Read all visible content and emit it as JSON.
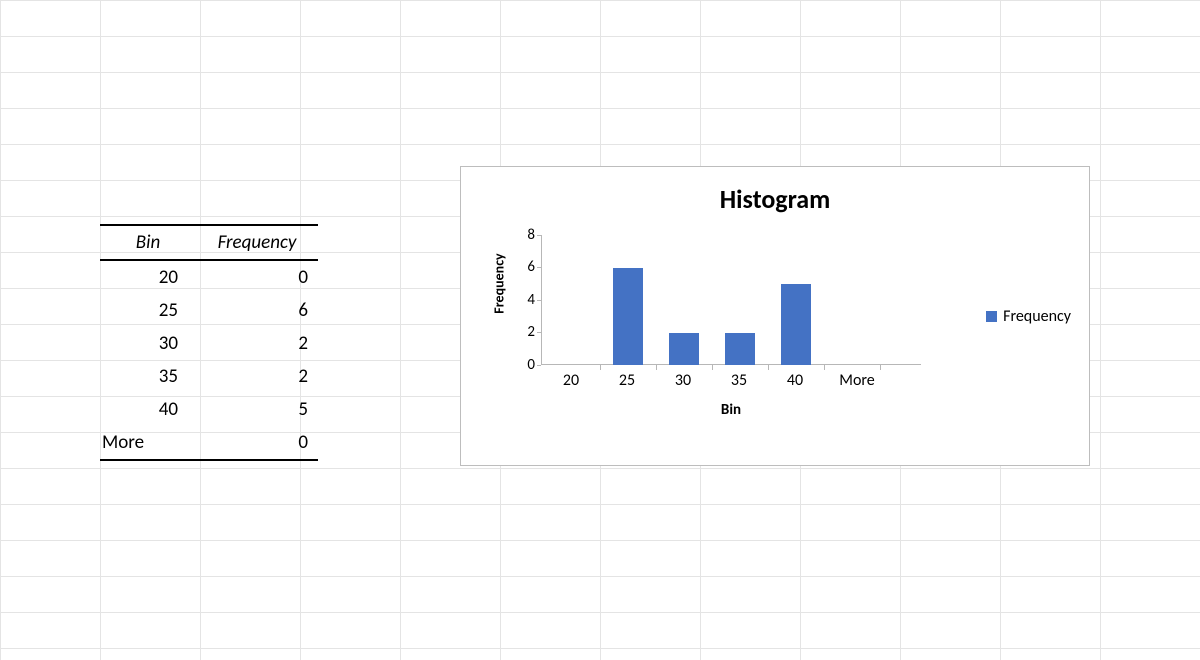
{
  "table": {
    "headers": {
      "bin": "Bin",
      "freq": "Frequency"
    },
    "rows": [
      {
        "bin": "20",
        "freq": "0"
      },
      {
        "bin": "25",
        "freq": "6"
      },
      {
        "bin": "30",
        "freq": "2"
      },
      {
        "bin": "35",
        "freq": "2"
      },
      {
        "bin": "40",
        "freq": "5"
      },
      {
        "bin": "More",
        "freq": "0"
      }
    ]
  },
  "chart": {
    "title": "Histogram",
    "xlabel": "Bin",
    "ylabel": "Frequency",
    "legend": "Frequency",
    "yticks": [
      "0",
      "2",
      "4",
      "6",
      "8"
    ],
    "xticks": [
      "20",
      "25",
      "30",
      "35",
      "40",
      "More"
    ]
  },
  "chart_data": {
    "type": "bar",
    "categories": [
      "20",
      "25",
      "30",
      "35",
      "40",
      "More"
    ],
    "values": [
      0,
      6,
      2,
      2,
      5,
      0
    ],
    "title": "Histogram",
    "xlabel": "Bin",
    "ylabel": "Frequency",
    "ylim": [
      0,
      8
    ],
    "series_name": "Frequency",
    "legend_position": "right",
    "grid": false
  }
}
